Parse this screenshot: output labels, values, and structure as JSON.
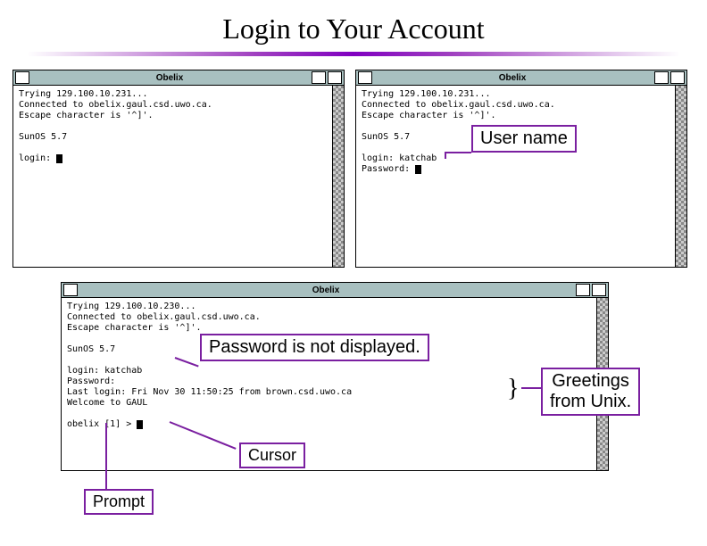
{
  "title": "Login to Your Account",
  "colors": {
    "accent": "#7a1fa0",
    "titlebar": "#a8c0c0"
  },
  "terminals": {
    "t1": {
      "title": "Obelix",
      "lines": [
        "Trying 129.100.10.231...",
        "Connected to obelix.gaul.csd.uwo.ca.",
        "Escape character is '^]'.",
        "",
        "SunOS 5.7",
        "",
        "login: "
      ]
    },
    "t2": {
      "title": "Obelix",
      "lines": [
        "Trying 129.100.10.231...",
        "Connected to obelix.gaul.csd.uwo.ca.",
        "Escape character is '^]'.",
        "",
        "SunOS 5.7",
        "",
        "login: katchab",
        "Password: "
      ]
    },
    "t3": {
      "title": "Obelix",
      "lines": [
        "Trying 129.100.10.230...",
        "Connected to obelix.gaul.csd.uwo.ca.",
        "Escape character is '^]'.",
        "",
        "SunOS 5.7",
        "",
        "login: katchab",
        "Password:",
        "Last login: Fri Nov 30 11:50:25 from brown.csd.uwo.ca",
        "Welcome to GAUL",
        "",
        "obelix [1] > "
      ]
    }
  },
  "callouts": {
    "username": "User name",
    "password": "Password is not displayed.",
    "greetings_line1": "Greetings",
    "greetings_line2": "from Unix.",
    "cursor": "Cursor",
    "prompt": "Prompt"
  }
}
